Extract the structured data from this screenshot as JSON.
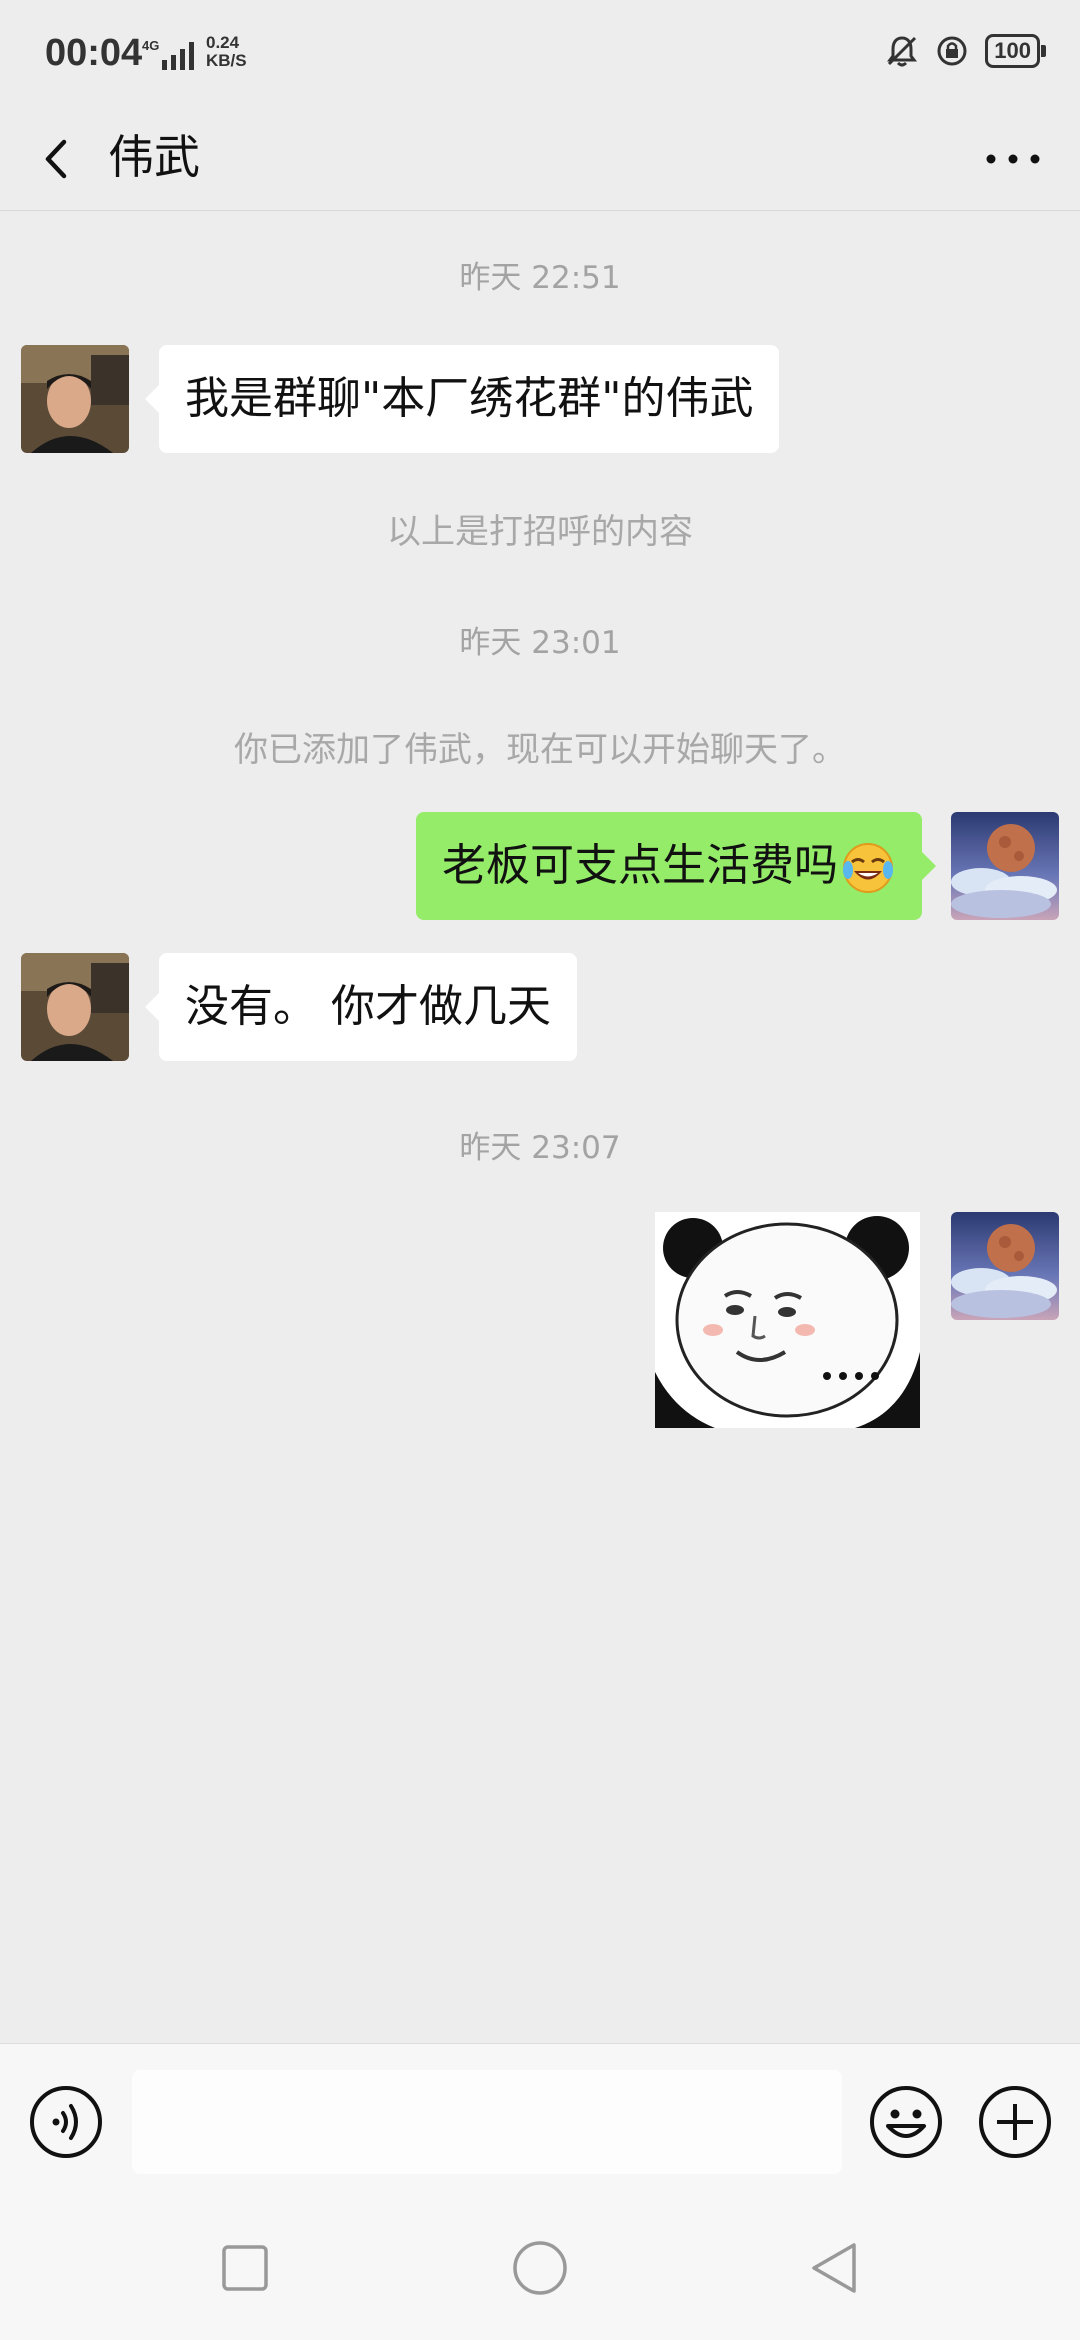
{
  "status_bar": {
    "time": "00:04",
    "network": "4G",
    "speed_value": "0.24",
    "speed_unit": "KB/S",
    "battery": "100"
  },
  "header": {
    "title": "伟武",
    "back_icon": "chevron-left-icon",
    "more_icon": "more-dots-icon"
  },
  "messages": [
    {
      "type": "timestamp",
      "text": "昨天 22:51"
    },
    {
      "type": "received",
      "text": "我是群聊\"本厂绣花群\"的伟武"
    },
    {
      "type": "system",
      "text": "以上是打招呼的内容"
    },
    {
      "type": "timestamp",
      "text": "昨天 23:01"
    },
    {
      "type": "system",
      "text": "你已添加了伟武，现在可以开始聊天了。"
    },
    {
      "type": "sent",
      "text": "老板可支点生活费吗",
      "emoji": "laughing-crying-emoji"
    },
    {
      "type": "received",
      "text": "没有。 你才做几天"
    },
    {
      "type": "timestamp",
      "text": "昨天 23:07"
    },
    {
      "type": "sent-sticker",
      "sticker": "panda-face-sticker"
    }
  ],
  "input_bar": {
    "voice_icon": "voice-icon",
    "emoji_icon": "emoji-icon",
    "plus_icon": "plus-icon",
    "value": ""
  },
  "nav_bar": {
    "icons": [
      "recent-apps-icon",
      "home-icon",
      "back-icon"
    ]
  },
  "colors": {
    "background": "#ededed",
    "sent_bubble": "#95ec69",
    "received_bubble": "#ffffff"
  }
}
